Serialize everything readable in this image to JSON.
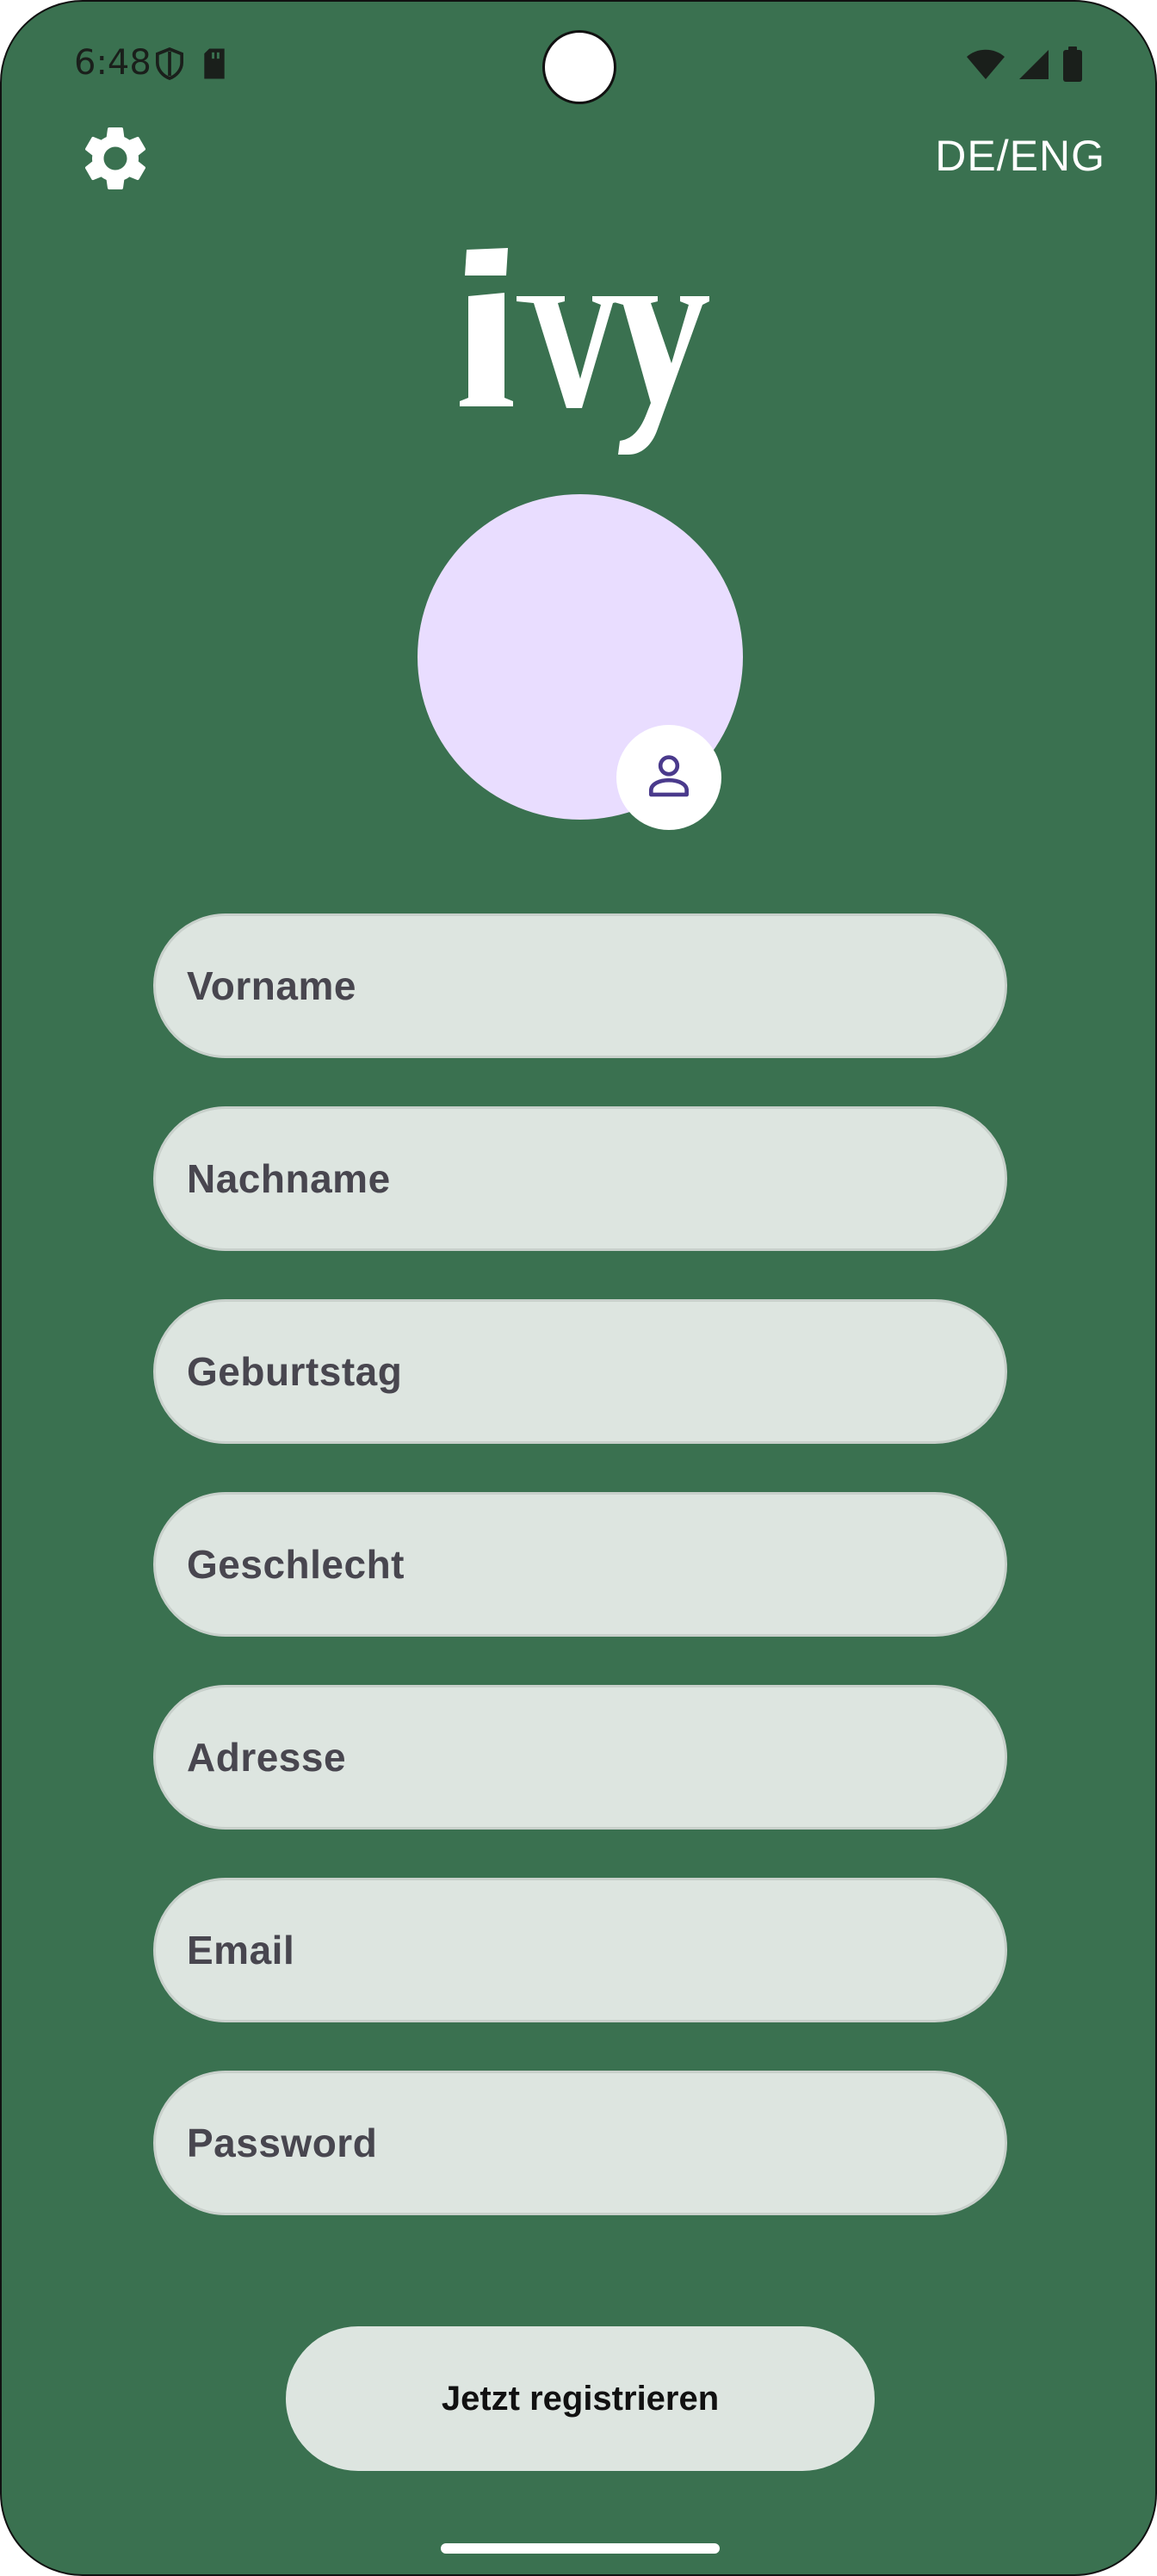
{
  "status_bar": {
    "time": "6:48",
    "left_icons": [
      "shield-icon",
      "sd-card-icon"
    ],
    "right_icons": [
      "wifi-icon",
      "cellular-signal-icon",
      "battery-icon"
    ]
  },
  "top_bar": {
    "settings_icon": "gear-icon",
    "language_toggle": "DE/ENG"
  },
  "logo": {
    "text": "ivy"
  },
  "avatar": {
    "badge_icon": "person-icon",
    "fill_color": "#e9ddff"
  },
  "form": {
    "fields": [
      {
        "placeholder": "Vorname"
      },
      {
        "placeholder": "Nachname"
      },
      {
        "placeholder": "Geburtstag"
      },
      {
        "placeholder": "Geschlecht"
      },
      {
        "placeholder": "Adresse"
      },
      {
        "placeholder": "Email"
      },
      {
        "placeholder": "Password"
      }
    ],
    "submit_label": "Jetzt registrieren"
  },
  "colors": {
    "background": "#3a7150",
    "field_fill": "#dde5e0",
    "accent_purple": "#4a3a8c"
  }
}
